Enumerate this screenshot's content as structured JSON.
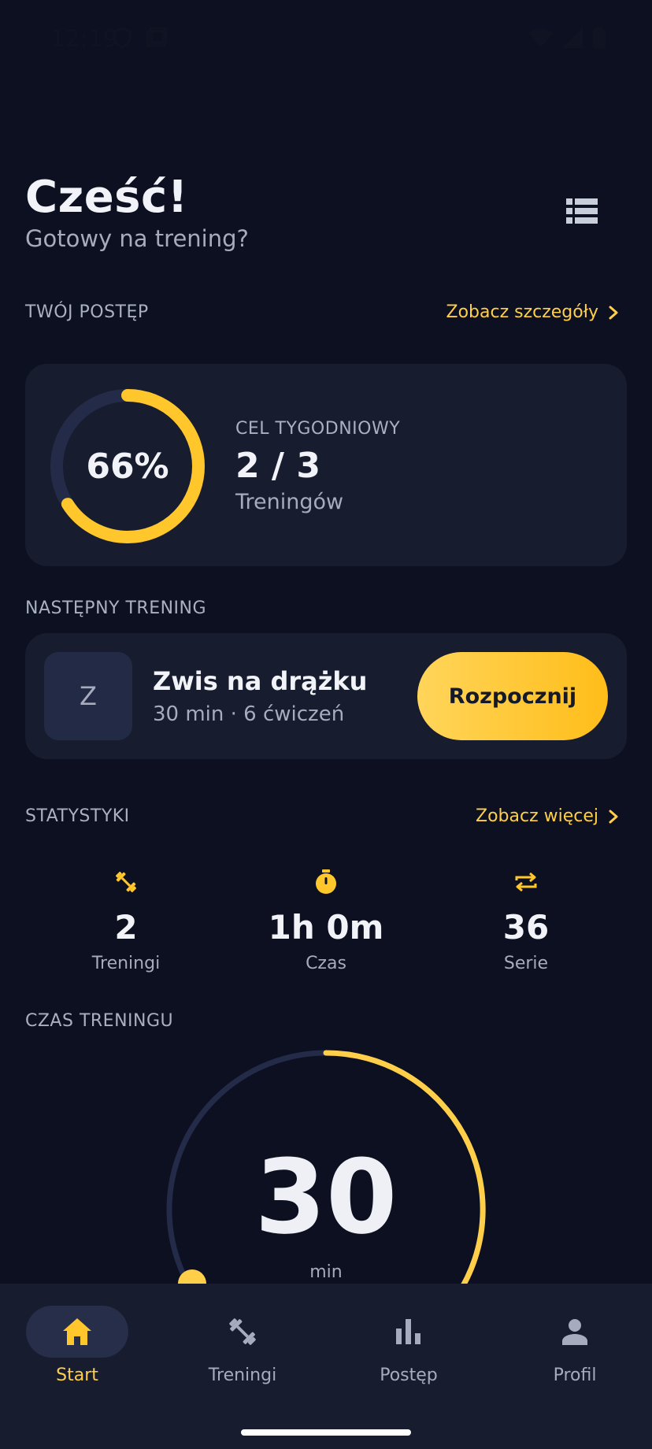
{
  "status_bar": {
    "time": "12:19"
  },
  "header": {
    "greeting": "Cześć!",
    "subtitle": "Gotowy na trening?"
  },
  "progress_section": {
    "title": "TWÓJ POSTĘP",
    "link": "Zobacz szczegóły",
    "percent_label": "66%",
    "progress_fraction": 0.66,
    "goal_label": "CEL TYGODNIOWY",
    "goal_value": "2 / 3",
    "goal_unit": "Treningów"
  },
  "next_section": {
    "title": "NASTĘPNY TRENING",
    "avatar_letter": "Z",
    "workout_name": "Zwis na drążku",
    "workout_meta": "30 min · 6 ćwiczeń",
    "start_label": "Rozpocznij"
  },
  "stats_section": {
    "title": "STATYSTYKI",
    "link": "Zobacz więcej",
    "items": [
      {
        "icon": "dumbbell-icon",
        "value": "2",
        "label": "Treningi"
      },
      {
        "icon": "timer-icon",
        "value": "1h 0m",
        "label": "Czas"
      },
      {
        "icon": "repeat-icon",
        "value": "36",
        "label": "Serie"
      }
    ]
  },
  "duration_section": {
    "title": "CZAS TRENINGU",
    "value": "30",
    "unit": "min"
  },
  "bottom_nav": {
    "items": [
      {
        "label": "Start",
        "icon": "home-icon",
        "active": true
      },
      {
        "label": "Treningi",
        "icon": "dumbbell-icon",
        "active": false
      },
      {
        "label": "Postęp",
        "icon": "bar-chart-icon",
        "active": false
      },
      {
        "label": "Profil",
        "icon": "person-icon",
        "active": false
      }
    ]
  },
  "colors": {
    "background": "#0c1020",
    "card": "#171c2e",
    "accent": "#ffc72c",
    "text_muted": "#a6abbd"
  }
}
